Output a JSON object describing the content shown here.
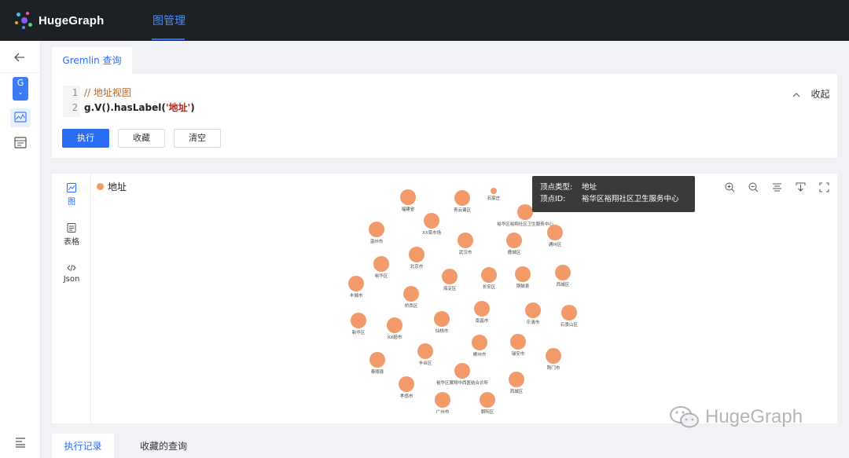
{
  "app": {
    "name": "HugeGraph",
    "nav_tab": "图管理"
  },
  "rail": {
    "back_icon": "arrow-left-icon",
    "graph_chip": {
      "letter": "G",
      "caret": "⌄"
    },
    "items": [
      {
        "icon": "chart-icon",
        "active": true
      },
      {
        "icon": "data-panel-icon",
        "active": false
      }
    ],
    "bottom_icon": "menu-icon"
  },
  "query": {
    "tab_label": "Gremlin 查询",
    "line_numbers": [
      "1",
      "2"
    ],
    "line1": "// 地址视图",
    "line2_prefix": "g.V().hasLabel(",
    "line2_string": "'地址'",
    "line2_suffix": ")",
    "collapse_label": "收起",
    "run_label": "执行",
    "favorite_label": "收藏",
    "clear_label": "清空"
  },
  "result": {
    "views": [
      {
        "label": "图",
        "icon": "graph-view-icon",
        "active": true
      },
      {
        "label": "表格",
        "icon": "table-view-icon",
        "active": false
      },
      {
        "label": "Json",
        "icon": "code-icon",
        "active": false
      }
    ],
    "legend_label": "地址",
    "node_color": "#f39a6a",
    "tools": [
      "zoom-in-icon",
      "zoom-out-icon",
      "layout-icon",
      "download-icon",
      "fullscreen-icon"
    ],
    "tooltip": {
      "type_key": "顶点类型:",
      "type_value": "地址",
      "id_key": "顶点ID:",
      "id_value": "裕华区裕翔社区卫生服务中心"
    }
  },
  "graph_nodes": [
    {
      "label": "福建省"
    },
    {
      "label": "青云谱区"
    },
    {
      "label": "石家庄"
    },
    {
      "label": "裕华区裕翔社区卫生服务中心"
    },
    {
      "label": "XX菜市场"
    },
    {
      "label": "温州市"
    },
    {
      "label": "武汉市"
    },
    {
      "label": "鹿城区"
    },
    {
      "label": "通州区"
    },
    {
      "label": "北京市"
    },
    {
      "label": "裕华区"
    },
    {
      "label": "海淀区"
    },
    {
      "label": "长安区"
    },
    {
      "label": "铜鼓县"
    },
    {
      "label": "西城区"
    },
    {
      "label": "丰城市"
    },
    {
      "label": "桥西区"
    },
    {
      "label": "南昌市"
    },
    {
      "label": "乐清市"
    },
    {
      "label": "石景山区"
    },
    {
      "label": "新华区"
    },
    {
      "label": "XX超市"
    },
    {
      "label": "仙桃市"
    },
    {
      "label": "郴州市"
    },
    {
      "label": "瑞安市"
    },
    {
      "label": "荆门市"
    },
    {
      "label": "丰台区"
    },
    {
      "label": "泰顺县"
    },
    {
      "label": "裕华区翼翔中西医结合诊所"
    },
    {
      "label": "西城区"
    },
    {
      "label": "孝感市"
    },
    {
      "label": "广州市"
    },
    {
      "label": "朝阳区"
    }
  ],
  "bottom_tabs": {
    "history_label": "执行记录",
    "favorites_label": "收藏的查询"
  },
  "watermark": {
    "text": "HugeGraph"
  }
}
